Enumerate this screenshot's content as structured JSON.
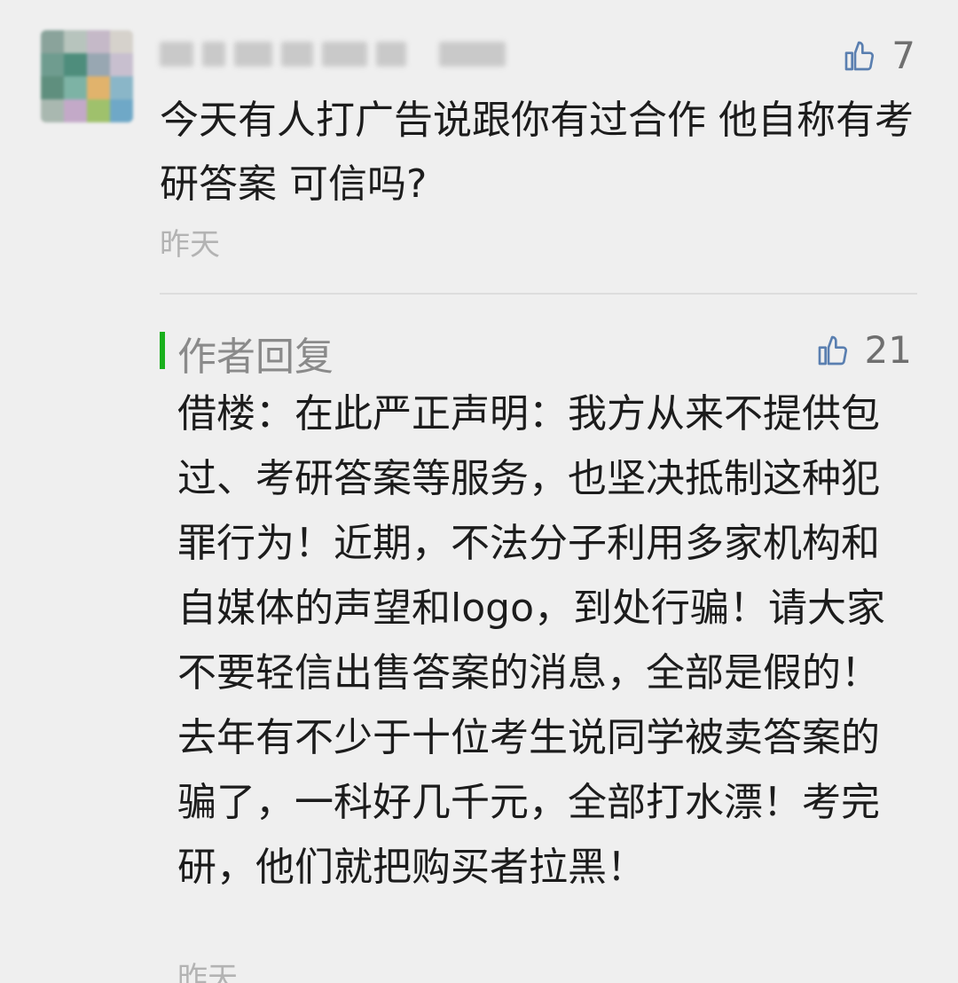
{
  "comment": {
    "likes": "7",
    "text": "今天有人打广告说跟你有过合作 他自称有考研答案 可信吗?",
    "time": "昨天"
  },
  "reply": {
    "label": "作者回复",
    "likes": "21",
    "text": "借楼：在此严正声明：我方从来不提供包过、考研答案等服务，也坚决抵制这种犯罪行为！近期，不法分子利用多家机构和自媒体的声望和logo，到处行骗！请大家不要轻信出售答案的消息，全部是假的！去年有不少于十位考生说同学被卖答案的骗了，一科好几千元，全部打水漂！考完研，他们就把购买者拉黑！",
    "time": "昨天"
  },
  "icons": {
    "like": "thumbs-up-icon",
    "avatar_colors": [
      "#8aa39b",
      "#b7c4bd",
      "#c5b9c8",
      "#d6d2cc",
      "#6f9c8f",
      "#4e8d7c",
      "#98a7b2",
      "#c8bfcf",
      "#5f8f7e",
      "#7db3a5",
      "#e1b36c",
      "#8ab6c8",
      "#a9b8b0",
      "#c3a9c8",
      "#9fc16c",
      "#6fa8c7"
    ]
  }
}
